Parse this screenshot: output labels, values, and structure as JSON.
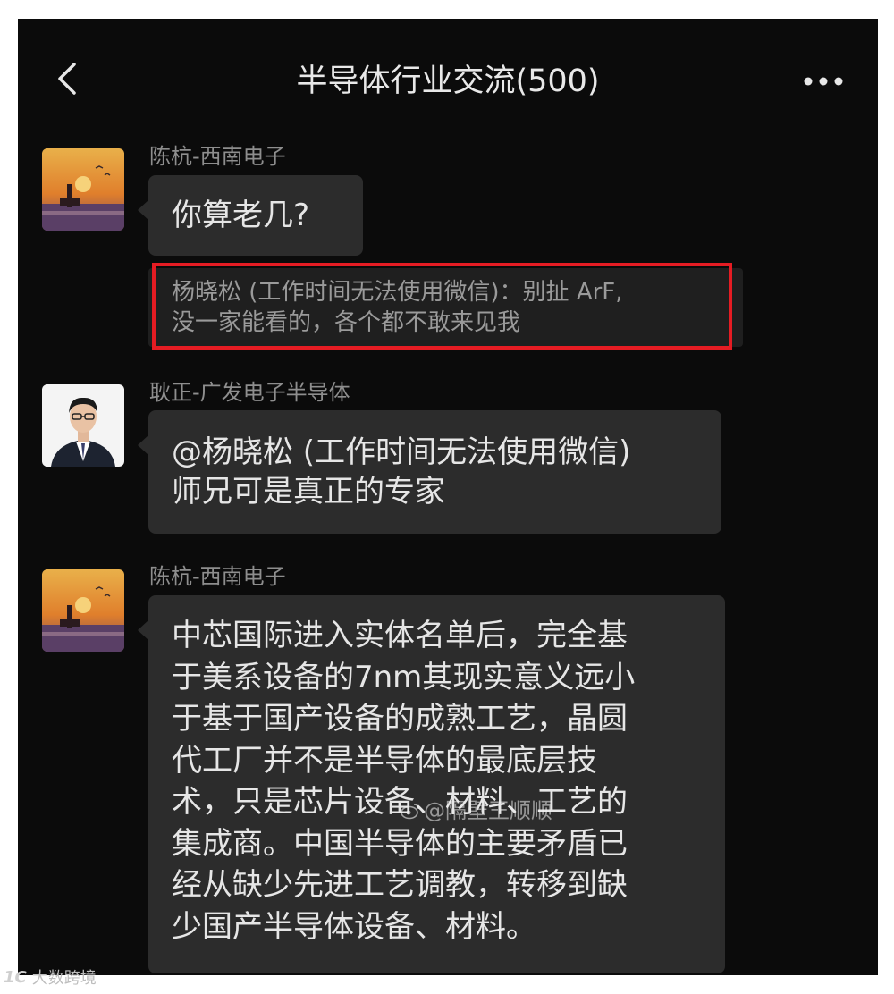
{
  "header": {
    "title": "半导体行业交流(500)",
    "back_icon": "chevron-left-icon",
    "more_icon": "more-dots-icon"
  },
  "messages": [
    {
      "sender": "陈杭-西南电子",
      "text": "你算老几?",
      "quote": "杨晓松 (工作时间无法使用微信)：别扯 ArF,\n没一家能看的，各个都不敢来见我"
    },
    {
      "sender": "耿正-广发电子半导体",
      "text": "@杨晓松 (工作时间无法使用微信)\n师兄可是真正的专家"
    },
    {
      "sender": "陈杭-西南电子",
      "text": "中芯国际进入实体名单后，完全基\n于美系设备的7nm其现实意义远小\n于基于国产设备的成熟工艺，晶圆\n代工厂并不是半导体的最底层技\n术，只是芯片设备、材料、工艺的\n集成商。中国半导体的主要矛盾已\n经从缺少先进工艺调教，转移到缺\n少国产半导体设备、材料。"
    }
  ],
  "watermark": "@隔壁王顺顺",
  "footer": {
    "logo": "1C",
    "text": "大数跨境"
  },
  "colors": {
    "background": "#0b0b0b",
    "bubble": "#2c2c2c",
    "highlight": "#e51c23"
  }
}
